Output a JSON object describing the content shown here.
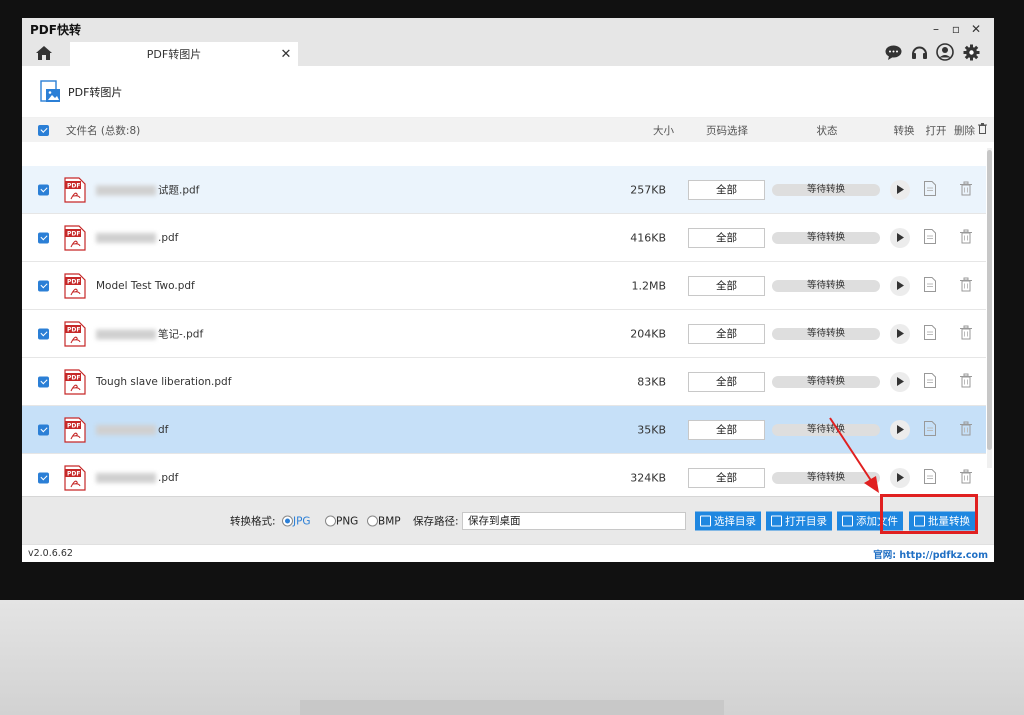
{
  "window": {
    "title": "PDF快转",
    "controls": [
      "–",
      "▫",
      "✕"
    ]
  },
  "tab": {
    "label": "PDF转图片",
    "close": "✕"
  },
  "page": {
    "title": "PDF转图片"
  },
  "list_header": {
    "name": "文件名 (总数:8)",
    "size": "大小",
    "range": "页码选择",
    "status": "状态",
    "convert": "转换",
    "open": "打开",
    "delete": "删除"
  },
  "files": [
    {
      "name": "试题.pdf",
      "blurred": true,
      "size": "257KB",
      "range": "全部",
      "status": "等待转换"
    },
    {
      "name": ".pdf",
      "blurred": true,
      "size": "416KB",
      "range": "全部",
      "status": "等待转换"
    },
    {
      "name": "Model Test Two.pdf",
      "blurred": false,
      "size": "1.2MB",
      "range": "全部",
      "status": "等待转换"
    },
    {
      "name": "笔记-.pdf",
      "blurred": true,
      "size": "204KB",
      "range": "全部",
      "status": "等待转换"
    },
    {
      "name": "Tough slave liberation.pdf",
      "blurred": false,
      "size": "83KB",
      "range": "全部",
      "status": "等待转换"
    },
    {
      "name": "df",
      "blurred": true,
      "size": "35KB",
      "range": "全部",
      "status": "等待转换"
    },
    {
      "name": ".pdf",
      "blurred": true,
      "size": "324KB",
      "range": "全部",
      "status": "等待转换"
    }
  ],
  "bottom": {
    "format_label": "转换格式:",
    "formats": [
      "JPG",
      "PNG",
      "BMP"
    ],
    "selected_format": "JPG",
    "path_label": "保存路径:",
    "path_value": "保存到桌面",
    "btn_choose_dir": "选择目录",
    "btn_open_dir": "打开目录",
    "btn_add_file": "添加文件",
    "btn_batch": "批量转换"
  },
  "status_bar": {
    "version": "v2.0.6.62",
    "site": "官网: http://pdfkz.com"
  },
  "colors": {
    "accent": "#1f87e0",
    "selected_row": "#c6e0f8",
    "annotation": "#e02020"
  }
}
